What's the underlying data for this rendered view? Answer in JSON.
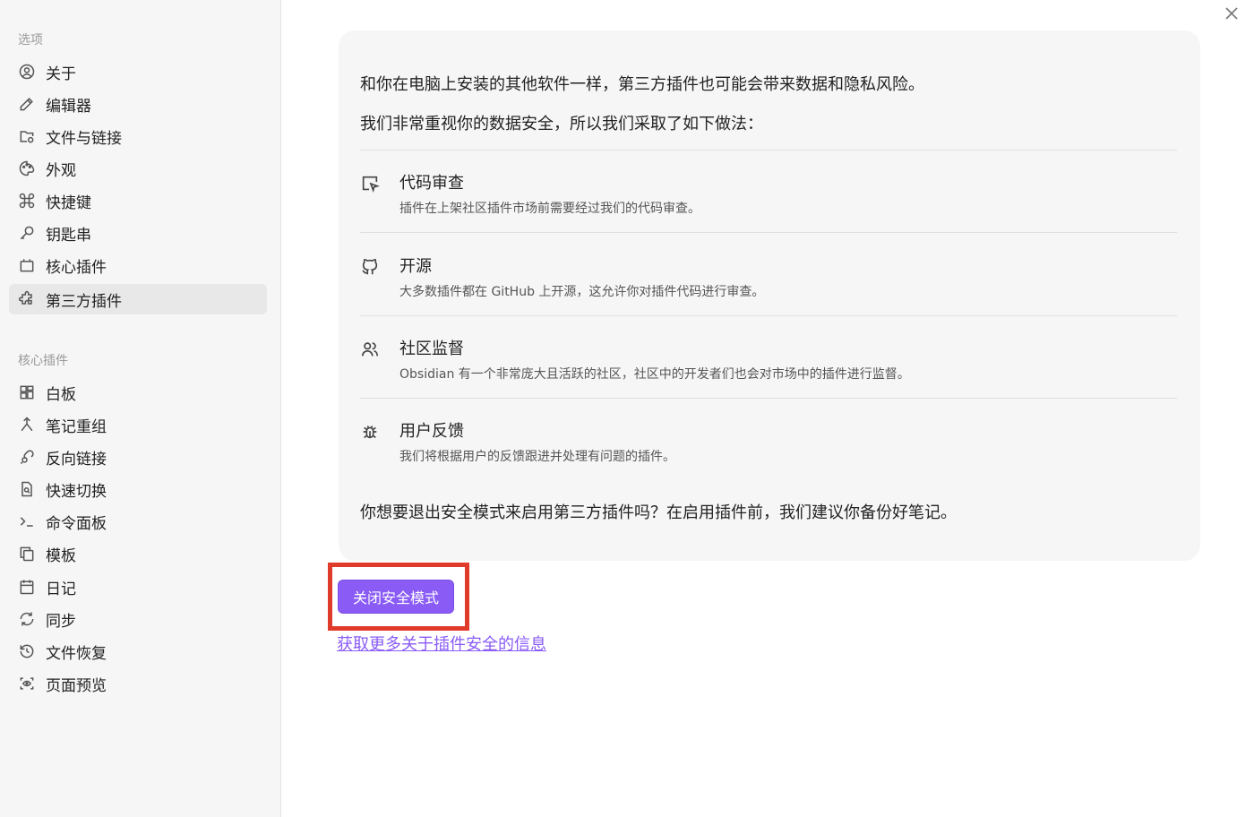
{
  "sidebar": {
    "options_title": "选项",
    "options": [
      {
        "label": "关于",
        "icon": "user-circle-icon"
      },
      {
        "label": "编辑器",
        "icon": "pencil-icon"
      },
      {
        "label": "文件与链接",
        "icon": "folder-settings-icon"
      },
      {
        "label": "外观",
        "icon": "palette-icon"
      },
      {
        "label": "快捷键",
        "icon": "command-icon"
      },
      {
        "label": "钥匙串",
        "icon": "key-icon"
      },
      {
        "label": "核心插件",
        "icon": "calendar-box-icon"
      },
      {
        "label": "第三方插件",
        "icon": "puzzle-icon",
        "active": true
      }
    ],
    "core_title": "核心插件",
    "core": [
      {
        "label": "白板",
        "icon": "grid-icon"
      },
      {
        "label": "笔记重组",
        "icon": "merge-icon"
      },
      {
        "label": "反向链接",
        "icon": "link-search-icon"
      },
      {
        "label": "快速切换",
        "icon": "file-search-icon"
      },
      {
        "label": "命令面板",
        "icon": "terminal-icon"
      },
      {
        "label": "模板",
        "icon": "copy-icon"
      },
      {
        "label": "日记",
        "icon": "calendar-icon"
      },
      {
        "label": "同步",
        "icon": "sync-icon"
      },
      {
        "label": "文件恢复",
        "icon": "history-icon"
      },
      {
        "label": "页面预览",
        "icon": "eye-scan-icon"
      }
    ]
  },
  "panel": {
    "intro1": "和你在电脑上安装的其他软件一样，第三方插件也可能会带来数据和隐私风险。",
    "intro2": "我们非常重视你的数据安全，所以我们采取了如下做法：",
    "features": [
      {
        "title": "代码审查",
        "desc": "插件在上架社区插件市场前需要经过我们的代码审查。",
        "icon": "cursor-review-icon"
      },
      {
        "title": "开源",
        "desc": "大多数插件都在 GitHub 上开源，这允许你对插件代码进行审查。",
        "icon": "github-icon"
      },
      {
        "title": "社区监督",
        "desc": "Obsidian 有一个非常庞大且活跃的社区，社区中的开发者们也会对市场中的插件进行监督。",
        "icon": "users-icon"
      },
      {
        "title": "用户反馈",
        "desc": "我们将根据用户的反馈跟进并处理有问题的插件。",
        "icon": "bug-icon"
      }
    ],
    "question": "你想要退出安全模式来启用第三方插件吗？在启用插件前，我们建议你备份好笔记。"
  },
  "actions": {
    "disable_safe_mode": "关闭安全模式",
    "more_info_link": "获取更多关于插件安全的信息"
  },
  "colors": {
    "accent": "#8a5cf5",
    "highlight": "#e03a2a"
  }
}
